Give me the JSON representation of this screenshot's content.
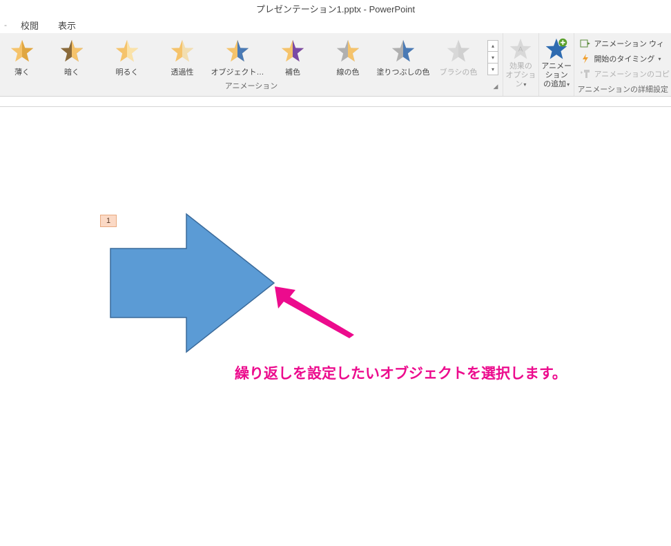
{
  "title": "プレゼンテーション1.pptx - PowerPoint",
  "tabs": {
    "sep": "-",
    "review": "校閲",
    "view": "表示"
  },
  "gallery": {
    "items": [
      {
        "label": "薄く",
        "fillA": "#f5c36b",
        "fillB": "#e0a640"
      },
      {
        "label": "暗く",
        "fillA": "#8a6a3a",
        "fillB": "#f5c36b"
      },
      {
        "label": "明るく",
        "fillA": "#f5c36b",
        "fillB": "#fae2a8"
      },
      {
        "label": "透過性",
        "fillA": "#f5c36b",
        "fillB": "#f2deb0"
      },
      {
        "label": "オブジェクト…",
        "fillA": "#f5c36b",
        "fillB": "#4a7ab5"
      },
      {
        "label": "補色",
        "fillA": "#f5c36b",
        "fillB": "#7a4aa6"
      },
      {
        "label": "線の色",
        "fillA": "#b0b0b0",
        "fillB": "#f5c36b"
      },
      {
        "label": "塗りつぶしの色",
        "fillA": "#b0b0b0",
        "fillB": "#4a7ab5"
      },
      {
        "label": "ブラシの色",
        "fillA": "#d8d8d8",
        "fillB": "#d0d0d0",
        "disabled": true
      }
    ],
    "group_label": "アニメーション"
  },
  "effect_options": {
    "label1": "効果の",
    "label2": "オプション",
    "disabled": true
  },
  "add_animation": {
    "label1": "アニメーション",
    "label2": "の追加"
  },
  "side": {
    "pane": "アニメーション ウィ",
    "trigger": "開始のタイミング",
    "painter": "アニメーションのコピ",
    "group_label": "アニメーションの詳細設定"
  },
  "tag_number": "1",
  "annotation_text": "繰り返しを設定したいオブジェクトを選択します。"
}
